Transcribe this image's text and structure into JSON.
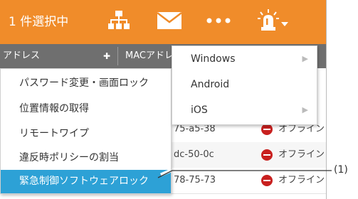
{
  "topbar": {
    "selection_text": "1 件選択中",
    "icons": [
      "org-chart-icon",
      "mail-icon",
      "more-icon",
      "alert-beacon-icon",
      "chevron-down-icon"
    ]
  },
  "table": {
    "columns": [
      "アドレス",
      "MACアドレ"
    ],
    "rows": [
      {
        "mac": "75-a5-38",
        "status": "オフライン"
      },
      {
        "mac": "dc-50-0c",
        "status": "オフライン"
      },
      {
        "mac": "78-75-73",
        "status": "オフライン"
      }
    ]
  },
  "context_menu": {
    "items": [
      {
        "label": "パスワード変更・画面ロック"
      },
      {
        "label": "位置情報の取得"
      },
      {
        "label": "リモートワイプ"
      },
      {
        "label": "違反時ポリシーの割当"
      },
      {
        "label": "緊急制御ソフトウェアロック",
        "active": true
      }
    ]
  },
  "submenu": {
    "items": [
      {
        "label": "Windows",
        "has_submenu": true
      },
      {
        "label": "Android",
        "has_submenu": false
      },
      {
        "label": "iOS",
        "has_submenu": true
      }
    ]
  },
  "callout": {
    "label": "(1)"
  },
  "colors": {
    "topbar": "#f08c2a",
    "highlight": "#2da1d6",
    "status_offline": "#c8201f",
    "header": "#6f6f6f"
  }
}
